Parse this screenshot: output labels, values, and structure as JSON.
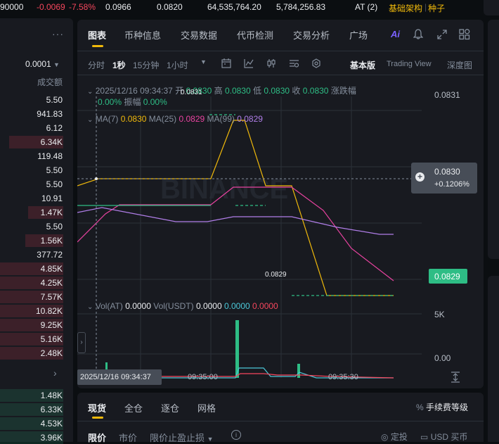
{
  "ticker": {
    "price_partial": "90000",
    "change": "-0.0069",
    "change_pct": "-7.58%",
    "high": "0.0966",
    "low": "0.0820",
    "vol_base": "64,535,764.20",
    "vol_quote": "5,784,256.83",
    "tag": "AT (2)",
    "tag_infra": "基础架构",
    "tag_seed": "种子"
  },
  "orderbook": {
    "more_icon": "ellipsis-icon",
    "precision": "0.0001",
    "header": "成交额",
    "asks": [
      {
        "v": "5.50",
        "fill": 0
      },
      {
        "v": "941.83",
        "fill": 0
      },
      {
        "v": "6.12",
        "fill": 0
      },
      {
        "v": "6.34K",
        "fill": 0.85
      },
      {
        "v": "119.48",
        "fill": 0
      },
      {
        "v": "5.50",
        "fill": 0
      },
      {
        "v": "5.50",
        "fill": 0
      },
      {
        "v": "10.91",
        "fill": 0
      },
      {
        "v": "1.47K",
        "fill": 0.55
      },
      {
        "v": "5.50",
        "fill": 0
      },
      {
        "v": "1.56K",
        "fill": 0.6
      },
      {
        "v": "377.72",
        "fill": 0
      },
      {
        "v": "4.85K",
        "fill": 1
      },
      {
        "v": "4.25K",
        "fill": 1
      },
      {
        "v": "7.57K",
        "fill": 1
      },
      {
        "v": "10.82K",
        "fill": 1
      },
      {
        "v": "9.25K",
        "fill": 1
      },
      {
        "v": "5.16K",
        "fill": 1
      },
      {
        "v": "2.48K",
        "fill": 1
      }
    ],
    "bids": [
      {
        "v": "1.48K",
        "fill": 1
      },
      {
        "v": "6.33K",
        "fill": 1
      },
      {
        "v": "4.53K",
        "fill": 1
      },
      {
        "v": "3.96K",
        "fill": 1
      }
    ]
  },
  "chart_tabs": [
    "图表",
    "币种信息",
    "交易数据",
    "代币检测",
    "交易分析",
    "广场"
  ],
  "ai_label": "Ai",
  "timeframes": [
    "分时",
    "1秒",
    "15分钟",
    "1小时"
  ],
  "views": {
    "basic": "基本版",
    "tradingview": "Trading View",
    "depth": "深度图"
  },
  "ohlc": {
    "datetime": "2025/12/16 09:34:37",
    "open_label": "开",
    "open": "0.0830",
    "high_label": "高",
    "high": "0.0830",
    "low_label": "低",
    "low": "0.0830",
    "close_label": "收",
    "close": "0.0830",
    "change_label": "涨跌幅",
    "change": "0.00%",
    "amp_label": "振幅",
    "amp": "0.00%"
  },
  "ma": {
    "ma7_label": "MA(7)",
    "ma7": "0.0830",
    "ma25_label": "MA(25)",
    "ma25": "0.0829",
    "ma99_label": "MA(99)",
    "ma99": "0.0829"
  },
  "vol": {
    "label": "Vol(AT)",
    "at": "0.0000",
    "usdt_label": "Vol(USDT)",
    "usdt": "0.0000",
    "v2": "0.0000",
    "v3": "0.0000",
    "axis_top": "5K",
    "axis_bottom": "0.00"
  },
  "axis": {
    "top_price": "0.0831",
    "cur_price": "0.0830",
    "cur_change": "+0.1206%",
    "last_price": "0.0829",
    "hi_marker": "0.0831",
    "lo_marker": "0.0829",
    "time_cursor": "2025/12/16 09:34:37",
    "time1": "09:35:00",
    "time2": "09:35:30"
  },
  "watermark": "BINANCE",
  "bottom": {
    "tabs": [
      "现货",
      "全仓",
      "逐仓",
      "网格"
    ],
    "fee": "手续费等级",
    "order_types": [
      "限价",
      "市价",
      "限价止盈止损"
    ],
    "plan": "定投",
    "buy": "USD 买币"
  },
  "colors": {
    "up": "#2ebd85",
    "down": "#f6465d",
    "accent": "#f0b90b",
    "ma25": "#e843a0",
    "ma99": "#b07ee8"
  }
}
